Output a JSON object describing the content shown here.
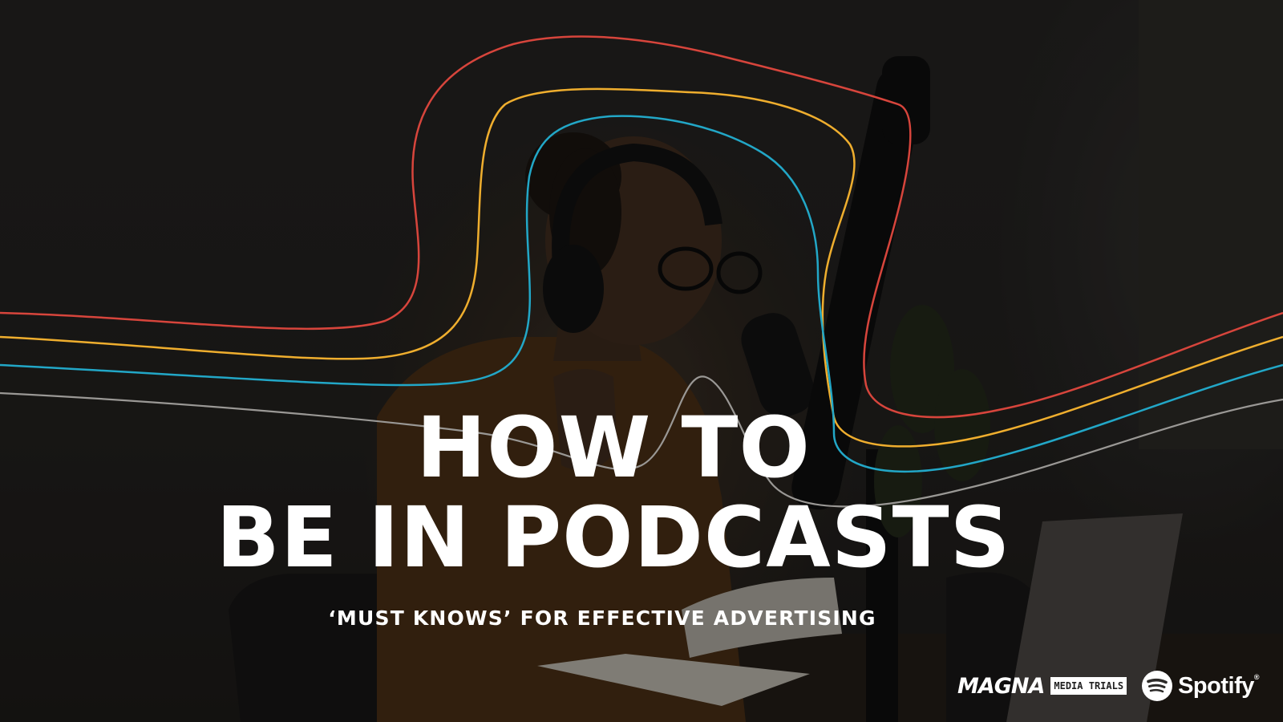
{
  "slide": {
    "title_line_1": "HOW TO",
    "title_line_2": "BE IN PODCASTS",
    "subtitle": "‘MUST KNOWS’ FOR EFFECTIVE ADVERTISING"
  },
  "logos": {
    "magna": "MAGNA",
    "media_trials": "MEDIA TRIALS",
    "spotify": "Spotify",
    "spotify_tm": "®"
  },
  "decor": {
    "wave_colors": [
      "#d7453c",
      "#efae2e",
      "#22a7c7",
      "#9a9895"
    ],
    "background_photo": "woman-with-headphones-speaking-into-microphone",
    "icons": [
      "spotify-icon"
    ]
  }
}
